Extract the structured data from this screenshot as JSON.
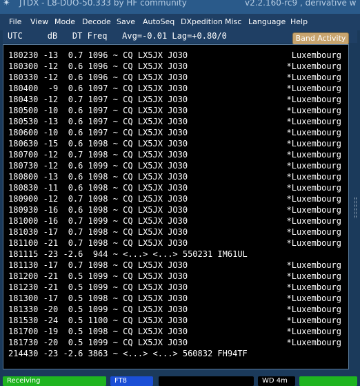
{
  "window": {
    "title_left": "JTDX - L8-DUO-50.333  by HF community",
    "title_right": "v2.2.160-rc9 , derivative w"
  },
  "menu": [
    "File",
    "View",
    "Mode",
    "Decode",
    "Save",
    "AutoSeq",
    "DXpedition",
    "Misc",
    "Language",
    "Help"
  ],
  "header": {
    "columns": "UTC     dB   DT Freq   Avg=-0.01 Lag=+0.80/0",
    "band_activity_label": "Band Activity"
  },
  "rows": [
    {
      "text": "180230 -13  0.7 1096 ~ CQ LX5JX JO30",
      "country": "Luxembourg"
    },
    {
      "text": "180300 -12  0.6 1096 ~ CQ LX5JX JO30",
      "country": "*Luxembourg"
    },
    {
      "text": "180330 -12  0.6 1096 ~ CQ LX5JX JO30",
      "country": "*Luxembourg"
    },
    {
      "text": "180400  -9  0.6 1097 ~ CQ LX5JX JO30",
      "country": "*Luxembourg"
    },
    {
      "text": "180430 -12  0.7 1097 ~ CQ LX5JX JO30",
      "country": "*Luxembourg"
    },
    {
      "text": "180500 -10  0.6 1097 ~ CQ LX5JX JO30",
      "country": "*Luxembourg"
    },
    {
      "text": "180530 -13  0.6 1097 ~ CQ LX5JX JO30",
      "country": "*Luxembourg"
    },
    {
      "text": "180600 -10  0.6 1097 ~ CQ LX5JX JO30",
      "country": "*Luxembourg"
    },
    {
      "text": "180630 -15  0.6 1098 ~ CQ LX5JX JO30",
      "country": "*Luxembourg"
    },
    {
      "text": "180700 -12  0.7 1098 ~ CQ LX5JX JO30",
      "country": "*Luxembourg"
    },
    {
      "text": "180730 -12  0.6 1099 ~ CQ LX5JX JO30",
      "country": "*Luxembourg"
    },
    {
      "text": "180800 -13  0.6 1098 ~ CQ LX5JX JO30",
      "country": "*Luxembourg"
    },
    {
      "text": "180830 -11  0.6 1098 ~ CQ LX5JX JO30",
      "country": "*Luxembourg"
    },
    {
      "text": "180900 -12  0.7 1098 ~ CQ LX5JX JO30",
      "country": "*Luxembourg"
    },
    {
      "text": "180930 -16  0.6 1098 ~ CQ LX5JX JO30",
      "country": "*Luxembourg"
    },
    {
      "text": "181000 -16  0.7 1099 ~ CQ LX5JX JO30",
      "country": "*Luxembourg"
    },
    {
      "text": "181030 -17  0.7 1098 ~ CQ LX5JX JO30",
      "country": "*Luxembourg"
    },
    {
      "text": "181100 -21  0.7 1098 ~ CQ LX5JX JO30",
      "country": "*Luxembourg"
    },
    {
      "text": "181115 -23 -2.6  944 ~ <...> <...> 550231 IM61UL",
      "country": ""
    },
    {
      "text": "181130 -17  0.7 1098 ~ CQ LX5JX JO30",
      "country": "*Luxembourg"
    },
    {
      "text": "181200 -21  0.5 1099 ~ CQ LX5JX JO30",
      "country": "*Luxembourg"
    },
    {
      "text": "181230 -21  0.5 1099 ~ CQ LX5JX JO30",
      "country": "*Luxembourg"
    },
    {
      "text": "181300 -17  0.5 1098 ~ CQ LX5JX JO30",
      "country": "*Luxembourg"
    },
    {
      "text": "181330 -20  0.5 1099 ~ CQ LX5JX JO30",
      "country": "*Luxembourg"
    },
    {
      "text": "181530 -24  0.5 1100 ~ CQ LX5JX JO30",
      "country": "*Luxembourg"
    },
    {
      "text": "181700 -19  0.5 1098 ~ CQ LX5JX JO30",
      "country": "*Luxembourg"
    },
    {
      "text": "181730 -20  0.5 1099 ~ CQ LX5JX JO30",
      "country": "*Luxembourg"
    },
    {
      "text": "214430 -23 -2.6 3863 ~ <...> <...> 560832 FH94TF",
      "country": ""
    }
  ],
  "status": {
    "mode_state": "Receiving",
    "mode": "FT8",
    "wd": "WD 4m"
  },
  "colors": {
    "receiving_bg": "#1fb520",
    "mode_bg": "#1b4fd6",
    "right_field_bg": "#1fb520"
  },
  "icons": {
    "app_icon": "antenna-icon"
  }
}
